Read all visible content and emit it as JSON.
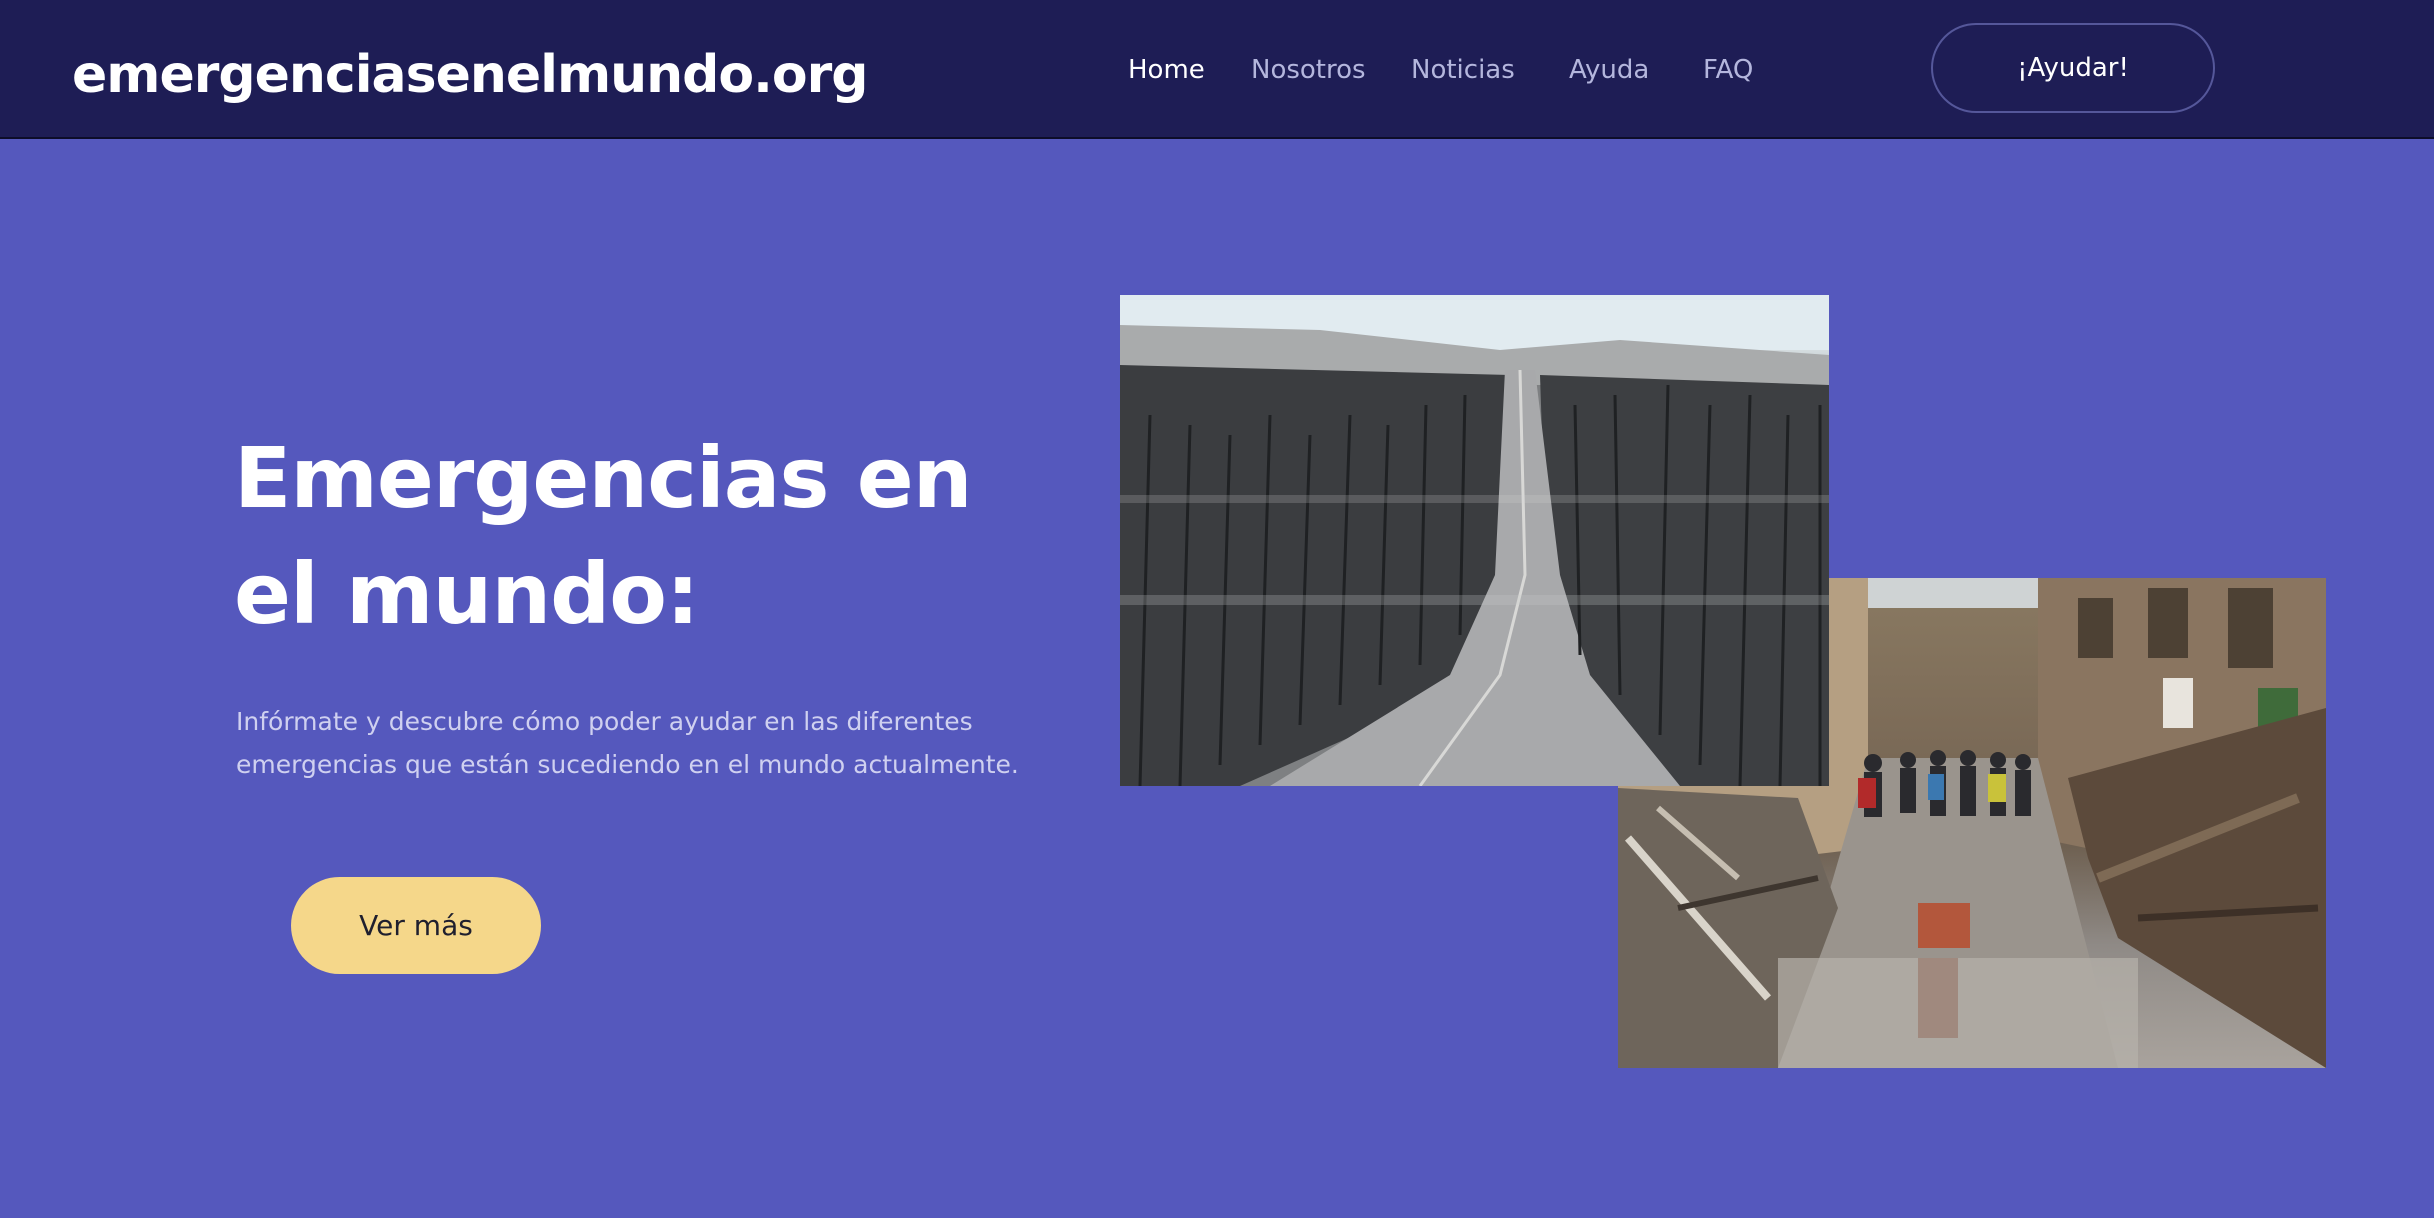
{
  "navbar": {
    "brand": "emergenciasenelmundo.org",
    "links": [
      {
        "label": "Home",
        "active": true
      },
      {
        "label": "Nosotros",
        "active": false
      },
      {
        "label": "Noticias",
        "active": false
      },
      {
        "label": "Ayuda",
        "active": false
      },
      {
        "label": "FAQ",
        "active": false
      }
    ],
    "cta_label": "¡Ayudar!"
  },
  "hero": {
    "title_line1": "Emergencias en",
    "title_line2": "el mundo:",
    "description_line1": "Infórmate y descubre cómo poder ayudar en las diferentes",
    "description_line2": "emergencias que están sucediendo en el mundo actualmente.",
    "button_label": "Ver más"
  },
  "colors": {
    "navbar_bg": "#1e1d55",
    "hero_bg": "#5558bd",
    "button_bg": "#f5d78a",
    "nav_text_inactive": "#b4b6dd",
    "nav_text_active": "#ffffff"
  }
}
